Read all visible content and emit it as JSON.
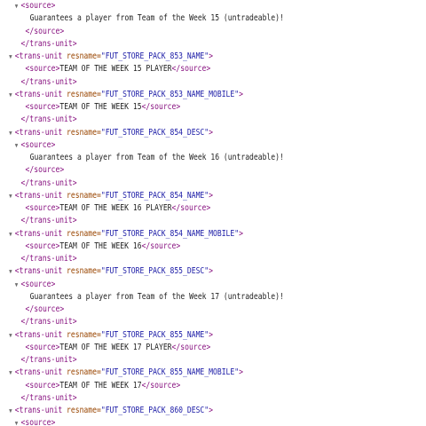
{
  "lines": [
    {
      "indent": 2,
      "toggle": "down",
      "parts": [
        {
          "t": "tag",
          "v": "<source>"
        }
      ]
    },
    {
      "indent": 4,
      "toggle": "",
      "parts": [
        {
          "t": "text",
          "v": "Guarantees a player from Team of the Week 15 (untradeable)!"
        }
      ]
    },
    {
      "indent": 3,
      "toggle": "",
      "parts": [
        {
          "t": "tag",
          "v": "</source>"
        }
      ]
    },
    {
      "indent": 2,
      "toggle": "",
      "parts": [
        {
          "t": "tag",
          "v": "</trans-unit>"
        }
      ]
    },
    {
      "indent": 1,
      "toggle": "down",
      "parts": [
        {
          "t": "tag",
          "v": "<trans-unit "
        },
        {
          "t": "attr",
          "v": "resname="
        },
        {
          "t": "val",
          "v": "\"FUT_STORE_PACK_853_NAME\""
        },
        {
          "t": "tag",
          "v": ">"
        }
      ]
    },
    {
      "indent": 3,
      "toggle": "",
      "parts": [
        {
          "t": "tag",
          "v": "<source>"
        },
        {
          "t": "text",
          "v": "TEAM OF THE WEEK 15 PLAYER"
        },
        {
          "t": "tag",
          "v": "</source>"
        }
      ]
    },
    {
      "indent": 2,
      "toggle": "",
      "parts": [
        {
          "t": "tag",
          "v": "</trans-unit>"
        }
      ]
    },
    {
      "indent": 1,
      "toggle": "down",
      "parts": [
        {
          "t": "tag",
          "v": "<trans-unit "
        },
        {
          "t": "attr",
          "v": "resname="
        },
        {
          "t": "val",
          "v": "\"FUT_STORE_PACK_853_NAME_MOBILE\""
        },
        {
          "t": "tag",
          "v": ">"
        }
      ]
    },
    {
      "indent": 3,
      "toggle": "",
      "parts": [
        {
          "t": "tag",
          "v": "<source>"
        },
        {
          "t": "text",
          "v": "TEAM OF THE WEEK 15"
        },
        {
          "t": "tag",
          "v": "</source>"
        }
      ]
    },
    {
      "indent": 2,
      "toggle": "",
      "parts": [
        {
          "t": "tag",
          "v": "</trans-unit>"
        }
      ]
    },
    {
      "indent": 1,
      "toggle": "down",
      "parts": [
        {
          "t": "tag",
          "v": "<trans-unit "
        },
        {
          "t": "attr",
          "v": "resname="
        },
        {
          "t": "val",
          "v": "\"FUT_STORE_PACK_854_DESC\""
        },
        {
          "t": "tag",
          "v": ">"
        }
      ]
    },
    {
      "indent": 2,
      "toggle": "down",
      "parts": [
        {
          "t": "tag",
          "v": "<source>"
        }
      ]
    },
    {
      "indent": 4,
      "toggle": "",
      "parts": [
        {
          "t": "text",
          "v": "Guarantees a player from Team of the Week 16 (untradeable)!"
        }
      ]
    },
    {
      "indent": 3,
      "toggle": "",
      "parts": [
        {
          "t": "tag",
          "v": "</source>"
        }
      ]
    },
    {
      "indent": 2,
      "toggle": "",
      "parts": [
        {
          "t": "tag",
          "v": "</trans-unit>"
        }
      ]
    },
    {
      "indent": 1,
      "toggle": "down",
      "parts": [
        {
          "t": "tag",
          "v": "<trans-unit "
        },
        {
          "t": "attr",
          "v": "resname="
        },
        {
          "t": "val",
          "v": "\"FUT_STORE_PACK_854_NAME\""
        },
        {
          "t": "tag",
          "v": ">"
        }
      ]
    },
    {
      "indent": 3,
      "toggle": "",
      "parts": [
        {
          "t": "tag",
          "v": "<source>"
        },
        {
          "t": "text",
          "v": "TEAM OF THE WEEK 16 PLAYER"
        },
        {
          "t": "tag",
          "v": "</source>"
        }
      ]
    },
    {
      "indent": 2,
      "toggle": "",
      "parts": [
        {
          "t": "tag",
          "v": "</trans-unit>"
        }
      ]
    },
    {
      "indent": 1,
      "toggle": "down",
      "parts": [
        {
          "t": "tag",
          "v": "<trans-unit "
        },
        {
          "t": "attr",
          "v": "resname="
        },
        {
          "t": "val",
          "v": "\"FUT_STORE_PACK_854_NAME_MOBILE\""
        },
        {
          "t": "tag",
          "v": ">"
        }
      ]
    },
    {
      "indent": 3,
      "toggle": "",
      "parts": [
        {
          "t": "tag",
          "v": "<source>"
        },
        {
          "t": "text",
          "v": "TEAM OF THE WEEK 16"
        },
        {
          "t": "tag",
          "v": "</source>"
        }
      ]
    },
    {
      "indent": 2,
      "toggle": "",
      "parts": [
        {
          "t": "tag",
          "v": "</trans-unit>"
        }
      ]
    },
    {
      "indent": 1,
      "toggle": "down",
      "parts": [
        {
          "t": "tag",
          "v": "<trans-unit "
        },
        {
          "t": "attr",
          "v": "resname="
        },
        {
          "t": "val",
          "v": "\"FUT_STORE_PACK_855_DESC\""
        },
        {
          "t": "tag",
          "v": ">"
        }
      ]
    },
    {
      "indent": 2,
      "toggle": "down",
      "parts": [
        {
          "t": "tag",
          "v": "<source>"
        }
      ]
    },
    {
      "indent": 4,
      "toggle": "",
      "parts": [
        {
          "t": "text",
          "v": "Guarantees a player from Team of the Week 17 (untradeable)!"
        }
      ]
    },
    {
      "indent": 3,
      "toggle": "",
      "parts": [
        {
          "t": "tag",
          "v": "</source>"
        }
      ]
    },
    {
      "indent": 2,
      "toggle": "",
      "parts": [
        {
          "t": "tag",
          "v": "</trans-unit>"
        }
      ]
    },
    {
      "indent": 1,
      "toggle": "down",
      "parts": [
        {
          "t": "tag",
          "v": "<trans-unit "
        },
        {
          "t": "attr",
          "v": "resname="
        },
        {
          "t": "val",
          "v": "\"FUT_STORE_PACK_855_NAME\""
        },
        {
          "t": "tag",
          "v": ">"
        }
      ]
    },
    {
      "indent": 3,
      "toggle": "",
      "parts": [
        {
          "t": "tag",
          "v": "<source>"
        },
        {
          "t": "text",
          "v": "TEAM OF THE WEEK 17 PLAYER"
        },
        {
          "t": "tag",
          "v": "</source>"
        }
      ]
    },
    {
      "indent": 2,
      "toggle": "",
      "parts": [
        {
          "t": "tag",
          "v": "</trans-unit>"
        }
      ]
    },
    {
      "indent": 1,
      "toggle": "down",
      "parts": [
        {
          "t": "tag",
          "v": "<trans-unit "
        },
        {
          "t": "attr",
          "v": "resname="
        },
        {
          "t": "val",
          "v": "\"FUT_STORE_PACK_855_NAME_MOBILE\""
        },
        {
          "t": "tag",
          "v": ">"
        }
      ]
    },
    {
      "indent": 3,
      "toggle": "",
      "parts": [
        {
          "t": "tag",
          "v": "<source>"
        },
        {
          "t": "text",
          "v": "TEAM OF THE WEEK 17"
        },
        {
          "t": "tag",
          "v": "</source>"
        }
      ]
    },
    {
      "indent": 2,
      "toggle": "",
      "parts": [
        {
          "t": "tag",
          "v": "</trans-unit>"
        }
      ]
    },
    {
      "indent": 1,
      "toggle": "down",
      "parts": [
        {
          "t": "tag",
          "v": "<trans-unit "
        },
        {
          "t": "attr",
          "v": "resname="
        },
        {
          "t": "val",
          "v": "\"FUT_STORE_PACK_860_DESC\""
        },
        {
          "t": "tag",
          "v": ">"
        }
      ]
    },
    {
      "indent": 2,
      "toggle": "down",
      "parts": [
        {
          "t": "tag",
          "v": "<source>"
        }
      ]
    }
  ],
  "icons": {
    "expanded": "disclosure-triangle-down"
  },
  "colors": {
    "tag": "#881280",
    "attr": "#994500",
    "value": "#1a1aa6",
    "text": "#222222",
    "toggle": "#6e6e6e"
  }
}
